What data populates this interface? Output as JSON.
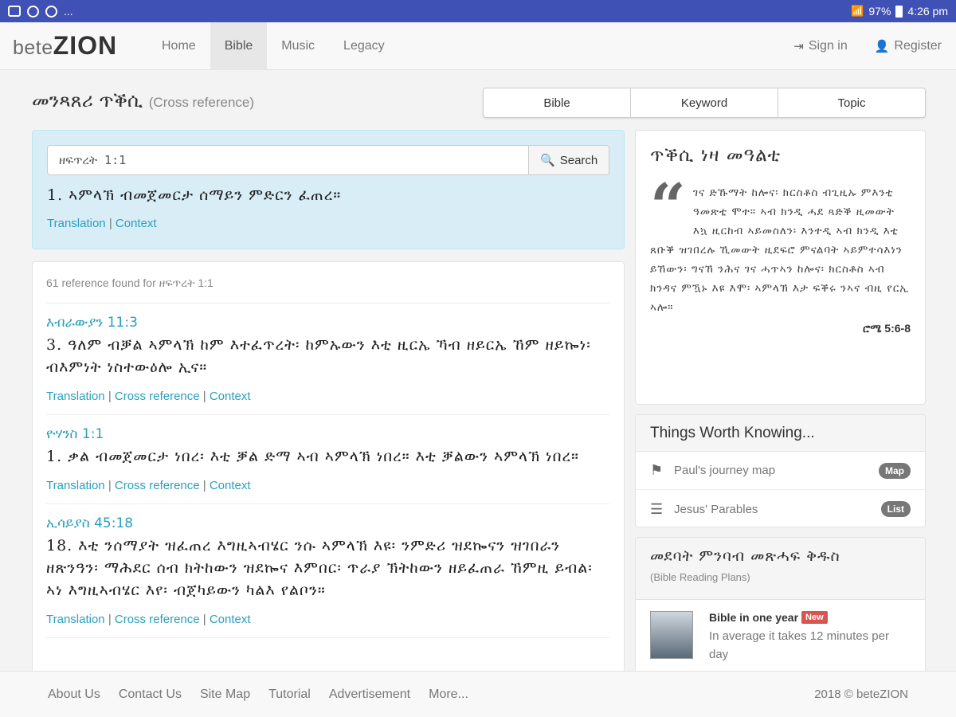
{
  "status_bar": {
    "more": "...",
    "battery": "97%",
    "time": "4:26 pm"
  },
  "navbar": {
    "brand_light": "bete",
    "brand_bold": "ZION",
    "items": [
      {
        "label": "Home",
        "active": false
      },
      {
        "label": "Bible",
        "active": true
      },
      {
        "label": "Music",
        "active": false
      },
      {
        "label": "Legacy",
        "active": false
      }
    ],
    "sign_in": "Sign in",
    "register": "Register"
  },
  "page": {
    "title": "መንጻጸሪ ጥቕሲ",
    "subtitle": "(Cross reference)",
    "segments": [
      "Bible",
      "Keyword",
      "Topic"
    ]
  },
  "search": {
    "value": "ዘፍጥረት 1:1",
    "button": "Search",
    "verse": "1. ኣምላኽ ብመጀመርታ ሰማይን ምድርን ፈጠረ።",
    "link_translation": "Translation",
    "link_context": "Context"
  },
  "results": {
    "found": "61 reference found for ዘፍጥረት 1:1",
    "link_translation": "Translation",
    "link_cross_reference": "Cross reference",
    "link_context": "Context",
    "items": [
      {
        "title": "እብራውያን 11:3",
        "text": "3. ዓለም ብቓል ኣምላኽ ከም እተፈጥረት፡ ከምኡውን እቲ ዚርኤ ኻብ ዘይርኤ ኸም ዘይኰነ፡ ብእምነት ነስተውዕሎ ኢና።"
      },
      {
        "title": "ዮሃንስ 1:1",
        "text": "1. ቃል ብመጀመርታ ነበረ፡ እቲ ቓል ድማ ኣብ ኣምላኽ ነበረ። እቲ ቓልውን ኣምላኽ ነበረ።"
      },
      {
        "title": "ኢሳይያስ 45:18",
        "text": "18. እቲ ንሰማያት ዝፈጠረ እግዚኣብሄር ንሱ ኣምላኽ እዩ፡ ንምድሪ ዝደኰናን ዝገበራን ዘጽንዓን፡ ማሕደር ሰብ ክትከውን ዝደኰና እምበር፡ ጥራያ ኽትከውን ዘይፈጠራ ኸምዚ ይብል፡ ኣነ እግዚኣብሄር እየ፡ ብጀካይውን ካልእ የልቦን።"
      }
    ]
  },
  "quote": {
    "title": "ጥቕሲ ነዛ መዓልቲ",
    "text": "ገና ድኹማት ከሎና፡ ክርስቶስ ብጊዚኡ ምእንቲ ዓመጽቲ ሞተ። ኣብ ክንዲ ሓደ ጻድቕ ዚመውት እኳ ዚርከብ ኣይመስለን፡ እንተዲ ኣብ ክንዲ እቲ ጸቡቕ ዝገበረሉ ኺመውት ዚደፍሮ ምናልባት ኣይምተሳእነን ይኸውን፡ ግናኸ ንሕና ገና ሓጥኣን ከሎና፡ ክርስቶስ ኣብ ክንዳና ምዃኑ እዩ እሞ፡ ኣምላኽ እታ ፍቕሩ ንኣና ብዚ የርኢ ኣሎ።",
    "ref": "ሮሜ 5:6-8"
  },
  "things_worth_knowing": {
    "title": "Things Worth Knowing...",
    "items": [
      {
        "label": "Paul's journey map",
        "badge": "Map",
        "icon": "signpost-icon"
      },
      {
        "label": "Jesus' Parables",
        "badge": "List",
        "icon": "list-icon"
      }
    ]
  },
  "reading_plans": {
    "title": "መደባት ምንባብ መጽሓፍ ቅዱስ",
    "subtitle": "(Bible Reading Plans)",
    "plan_name": "Bible in one year",
    "plan_badge": "New",
    "plan_desc": "In average it takes 12 minutes per day"
  },
  "footer": {
    "links": [
      "About Us",
      "Contact Us",
      "Site Map",
      "Tutorial",
      "Advertisement",
      "More..."
    ],
    "copyright": "2018 © beteZION"
  },
  "colors": {
    "status_bar": "#3f51b5",
    "link": "#2a9fbd",
    "search_panel_bg": "#d9edf7",
    "badge": "#777777",
    "new_badge": "#d9534f"
  }
}
